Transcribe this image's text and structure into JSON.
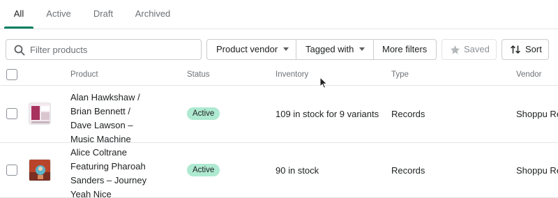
{
  "tabs": [
    "All",
    "Active",
    "Draft",
    "Archived"
  ],
  "search": {
    "placeholder": "Filter products",
    "value": ""
  },
  "filters": {
    "vendor_label": "Product vendor",
    "tagged_label": "Tagged with",
    "more_label": "More filters",
    "saved_label": "Saved",
    "sort_label": "Sort"
  },
  "table": {
    "headers": {
      "product": "Product",
      "status": "Status",
      "inventory": "Inventory",
      "type": "Type",
      "vendor": "Vendor"
    },
    "rows": [
      {
        "name_lines": [
          "Alan Hawkshaw /",
          "Brian Bennett /",
          "Dave Lawson –",
          "Music Machine"
        ],
        "status": "Active",
        "inventory": "109 in stock for 9 variants",
        "type": "Records",
        "vendor": "Shoppu Re"
      },
      {
        "name_lines": [
          "Alice Coltrane",
          "Featuring Pharoah",
          "Sanders – Journey",
          "Yeah Nice"
        ],
        "status": "Active",
        "inventory": "90 in stock",
        "type": "Records",
        "vendor": "Shoppu Re"
      }
    ]
  },
  "colors": {
    "accent": "#008060",
    "badge_active": "#aee9d1",
    "border": "#c9cccf"
  },
  "icons": {
    "search": "search-icon",
    "saved": "star-icon",
    "sort": "sort-arrows-icon",
    "caret": "caret-down-icon"
  }
}
